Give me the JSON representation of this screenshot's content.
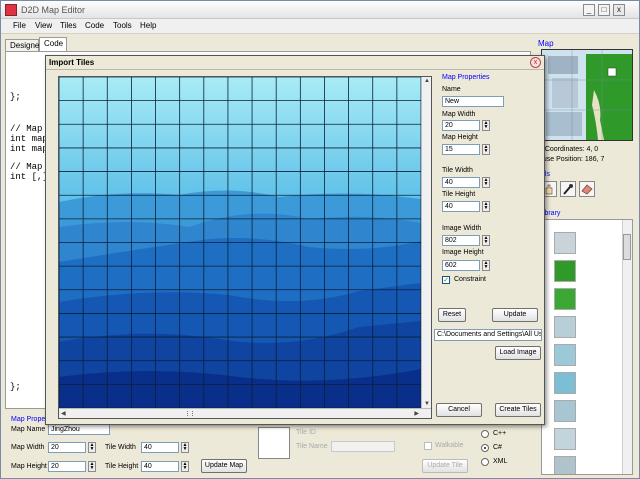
{
  "app": {
    "title": "D2D Map Editor",
    "controls": [
      "_",
      "□",
      "x"
    ]
  },
  "menu": [
    "File",
    "View",
    "Tiles",
    "Code",
    "Tools",
    "Help"
  ],
  "tabs": [
    "Designer",
    "Code"
  ],
  "code": [
    "};",
    "// Map s",
    "int mapW",
    "int mapH",
    "// Map A",
    "int [,]",
    "};"
  ],
  "side": {
    "map_label": "Map",
    "map_coordinates": "p Coordinates: 4, 0",
    "mouse_position": "ouse Position: 186, 7",
    "tools_label": "ols",
    "library_label": "Library"
  },
  "map_properties": {
    "label": "Map Propert",
    "name_label": "Map Name",
    "name_value": "JingZhou",
    "width_label": "Map Width",
    "width_value": "20",
    "height_label": "Map Height",
    "height_value": "20",
    "tile_width_label": "Tile Width",
    "tile_width_value": "40",
    "tile_height_label": "Tile Height",
    "tile_height_value": "40",
    "update_button": "Update Map"
  },
  "tile_properties": {
    "tile_id_label": "Tile ID",
    "tile_name_label": "Tile Name",
    "walkable_label": "Walkable",
    "update_button": "Update Tile"
  },
  "languages": {
    "options": [
      "C++",
      "C#",
      "XML"
    ],
    "selected": "C#"
  },
  "dialog": {
    "title": "Import Tiles",
    "close": "x",
    "group_label": "Map Properties",
    "name_label": "Name",
    "name_value": "New",
    "map_width_label": "Map Width",
    "map_width_value": "20",
    "map_height_label": "Map Height",
    "map_height_value": "15",
    "tile_width_label": "Tile Width",
    "tile_width_value": "40",
    "tile_height_label": "Tile Height",
    "tile_height_value": "40",
    "image_width_label": "Image Width",
    "image_width_value": "802",
    "image_height_label": "Image Height",
    "image_height_value": "602",
    "constraint_label": "Constraint",
    "constraint_checked": true,
    "reset_button": "Reset",
    "update_button": "Update",
    "path_value": "C:\\Documents and Settings\\All Us",
    "load_button": "Load Image",
    "cancel_button": "Cancel",
    "create_button": "Create Tiles",
    "grid_columns": 15,
    "grid_rows": 14
  },
  "colors": {
    "sky_top": "#a8ecf5",
    "sky_bottom": "#1a73cf",
    "mountain_dark": "#0a2f8a",
    "grass": "#2f9a2a",
    "link_blue": "#0000ff"
  }
}
